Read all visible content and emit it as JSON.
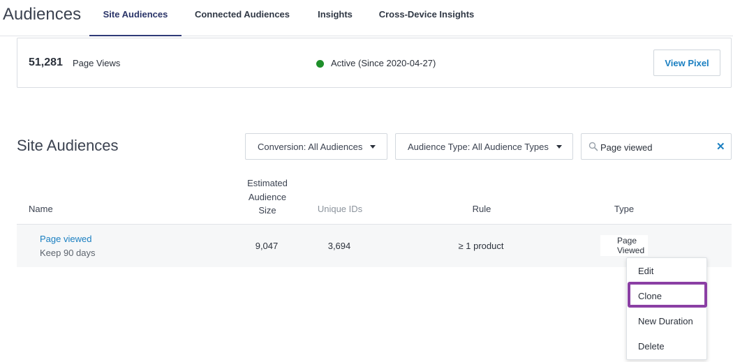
{
  "app": {
    "title": "Audiences"
  },
  "nav": {
    "tabs": [
      {
        "label": "Site Audiences",
        "active": true
      },
      {
        "label": "Connected Audiences",
        "active": false
      },
      {
        "label": "Insights",
        "active": false
      },
      {
        "label": "Cross-Device Insights",
        "active": false
      }
    ]
  },
  "summary": {
    "page_view_count": "51,281",
    "page_view_label": "Page Views",
    "status_text": "Active (Since 2020-04-27)",
    "status_color": "#1e8f2a",
    "view_pixel_label": "View Pixel"
  },
  "section": {
    "title": "Site Audiences",
    "filters": {
      "conversion": "Conversion: All Audiences",
      "audience_type": "Audience Type: All Audience Types"
    },
    "search": {
      "value": "Page viewed"
    }
  },
  "table": {
    "headers": {
      "name": "Name",
      "size": "Estimated Audience Size",
      "unique": "Unique IDs",
      "rule": "Rule",
      "type": "Type"
    },
    "rows": [
      {
        "name": "Page viewed",
        "duration": "Keep 90 days",
        "estimated_size": "9,047",
        "unique_ids": "3,694",
        "rule": "≥ 1 product",
        "type": "Page Viewed"
      }
    ]
  },
  "context_menu": {
    "items": [
      "Edit",
      "Clone",
      "New Duration",
      "Delete"
    ],
    "highlighted": "Clone",
    "highlight_color": "#8b3fa4"
  },
  "colors": {
    "link": "#1a7fc1",
    "active_tab_underline": "#2f3a78"
  }
}
